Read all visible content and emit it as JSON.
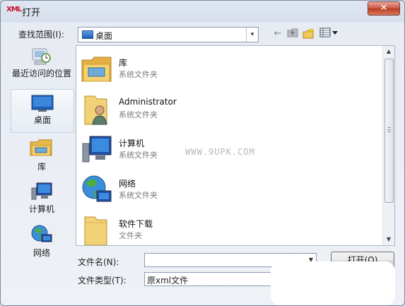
{
  "window": {
    "title": "打开",
    "app_icon_text": "XML",
    "close_glyph": "✕"
  },
  "lookin": {
    "label": "查找范围(I):",
    "value": "桌面",
    "arrow": "▾"
  },
  "toolbar": {
    "back": "←",
    "up": "↑",
    "new_folder": "★",
    "views": "▦▾"
  },
  "places": [
    {
      "label": "最近访问的位置",
      "icon": "recent-places-icon"
    },
    {
      "label": "桌面",
      "icon": "desktop-icon"
    },
    {
      "label": "库",
      "icon": "libraries-icon"
    },
    {
      "label": "计算机",
      "icon": "computer-icon"
    },
    {
      "label": "网络",
      "icon": "network-icon"
    }
  ],
  "files": [
    {
      "name": "库",
      "type": "系统文件夹",
      "icon": "libraries-folder-icon"
    },
    {
      "name": "Administrator",
      "type": "系统文件夹",
      "icon": "user-folder-icon"
    },
    {
      "name": "计算机",
      "type": "系统文件夹",
      "icon": "computer-icon"
    },
    {
      "name": "网络",
      "type": "系统文件夹",
      "icon": "network-globe-icon"
    },
    {
      "name": "软件下载",
      "type": "文件夹",
      "icon": "folder-icon"
    }
  ],
  "watermark": "WWW.9UPK.COM",
  "filename": {
    "label": "文件名(N):",
    "value": ""
  },
  "filetype": {
    "label": "文件类型(T):",
    "value": "原xml文件"
  },
  "buttons": {
    "open": "打开(O)"
  },
  "colors": {
    "accent": "#2c6fd1",
    "close": "#c9573f"
  }
}
